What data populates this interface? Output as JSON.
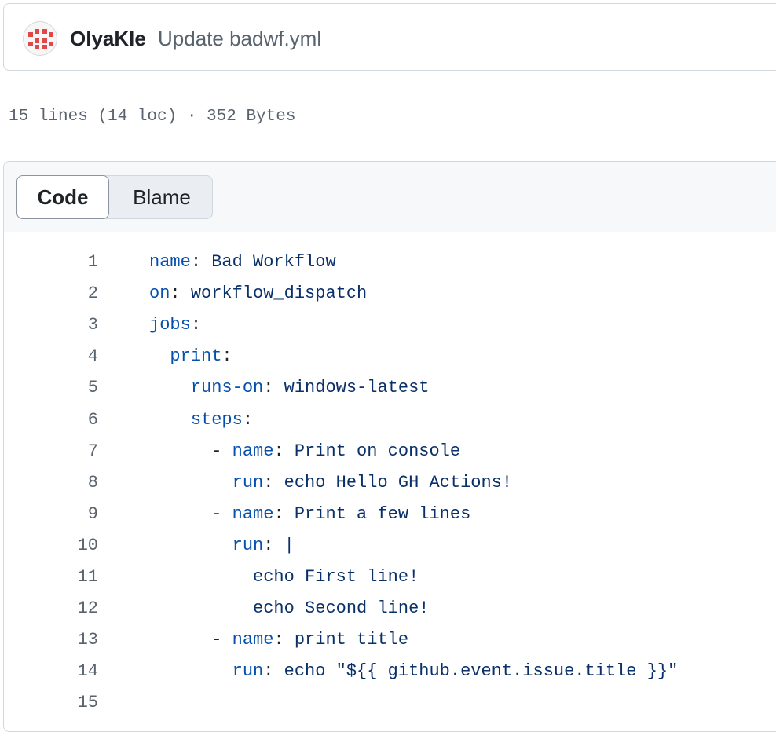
{
  "commit": {
    "author": "OlyaKle",
    "message": "Update badwf.yml"
  },
  "file": {
    "meta": "15 lines (14 loc) · 352 Bytes"
  },
  "view_toggle": {
    "code_label": "Code",
    "blame_label": "Blame",
    "selected": "Code"
  },
  "code": {
    "lines": [
      {
        "num": "1",
        "indent": "",
        "dash": "",
        "key": "name",
        "sep": ": ",
        "value": "Bad Workflow"
      },
      {
        "num": "2",
        "indent": "",
        "dash": "",
        "key": "on",
        "sep": ": ",
        "value": "workflow_dispatch"
      },
      {
        "num": "3",
        "indent": "",
        "dash": "",
        "key": "jobs",
        "sep": ":",
        "value": ""
      },
      {
        "num": "4",
        "indent": "  ",
        "dash": "",
        "key": "print",
        "sep": ":",
        "value": ""
      },
      {
        "num": "5",
        "indent": "    ",
        "dash": "",
        "key": "runs-on",
        "sep": ": ",
        "value": "windows-latest"
      },
      {
        "num": "6",
        "indent": "    ",
        "dash": "",
        "key": "steps",
        "sep": ":",
        "value": ""
      },
      {
        "num": "7",
        "indent": "      ",
        "dash": "- ",
        "key": "name",
        "sep": ": ",
        "value": "Print on console"
      },
      {
        "num": "8",
        "indent": "        ",
        "dash": "",
        "key": "run",
        "sep": ": ",
        "value": "echo Hello GH Actions!"
      },
      {
        "num": "9",
        "indent": "      ",
        "dash": "- ",
        "key": "name",
        "sep": ": ",
        "value": "Print a few lines"
      },
      {
        "num": "10",
        "indent": "        ",
        "dash": "",
        "key": "run",
        "sep": ": ",
        "value": "|"
      },
      {
        "num": "11",
        "indent": "          ",
        "dash": "",
        "key": "",
        "sep": "",
        "value": "echo First line!"
      },
      {
        "num": "12",
        "indent": "          ",
        "dash": "",
        "key": "",
        "sep": "",
        "value": "echo Second line!"
      },
      {
        "num": "13",
        "indent": "      ",
        "dash": "- ",
        "key": "name",
        "sep": ": ",
        "value": "print title"
      },
      {
        "num": "14",
        "indent": "        ",
        "dash": "",
        "key": "run",
        "sep": ": ",
        "value": "echo \"${{ github.event.issue.title }}\""
      },
      {
        "num": "15",
        "indent": "",
        "dash": "",
        "key": "",
        "sep": "",
        "value": ""
      }
    ]
  },
  "colors": {
    "key": "#0550ae",
    "value": "#0a3069",
    "line_number": "#59636e",
    "border": "#d0d7de"
  }
}
